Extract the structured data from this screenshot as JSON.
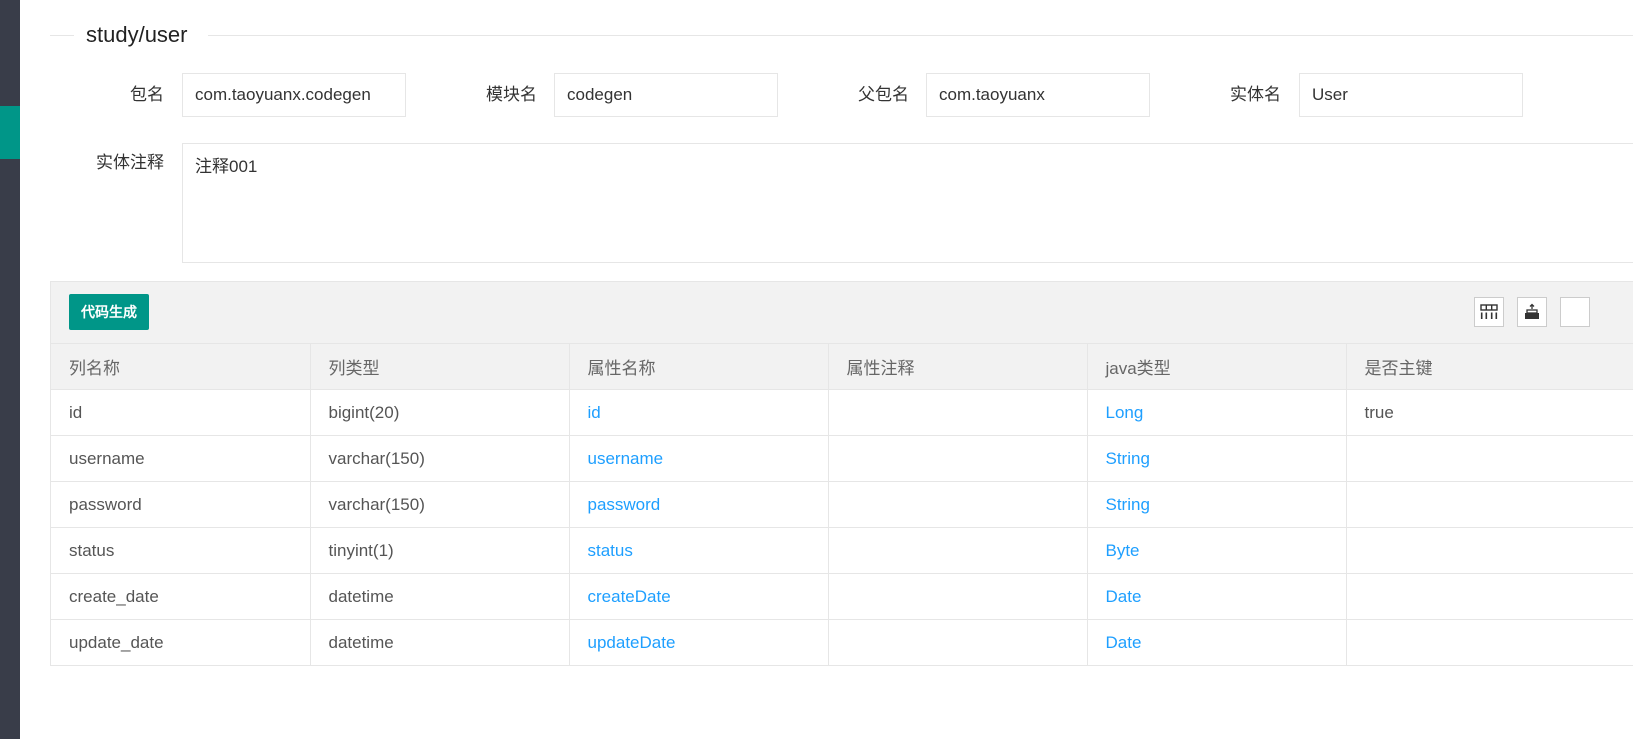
{
  "fieldset": {
    "legend": "study/user"
  },
  "form": {
    "package": {
      "label": "包名",
      "value": "com.taoyuanx.codegen"
    },
    "module": {
      "label": "模块名",
      "value": "codegen"
    },
    "parent_package": {
      "label": "父包名",
      "value": "com.taoyuanx"
    },
    "entity": {
      "label": "实体名",
      "value": "User"
    },
    "entity_comment": {
      "label": "实体注释",
      "value": "注释001"
    }
  },
  "toolbar": {
    "generate_label": "代码生成",
    "icons": [
      "columns-filter-icon",
      "export-icon",
      "print-icon"
    ]
  },
  "table": {
    "headers": [
      "列名称",
      "列类型",
      "属性名称",
      "属性注释",
      "java类型",
      "是否主键"
    ],
    "rows": [
      [
        "id",
        "bigint(20)",
        "id",
        "",
        "Long",
        "true"
      ],
      [
        "username",
        "varchar(150)",
        "username",
        "",
        "String",
        ""
      ],
      [
        "password",
        "varchar(150)",
        "password",
        "",
        "String",
        ""
      ],
      [
        "status",
        "tinyint(1)",
        "status",
        "",
        "Byte",
        ""
      ],
      [
        "create_date",
        "datetime",
        "createDate",
        "",
        "Date",
        ""
      ],
      [
        "update_date",
        "datetime",
        "updateDate",
        "",
        "Date",
        ""
      ]
    ]
  },
  "colors": {
    "sidebar": "#393d49",
    "accent": "#009688",
    "link": "#1e9fff"
  }
}
